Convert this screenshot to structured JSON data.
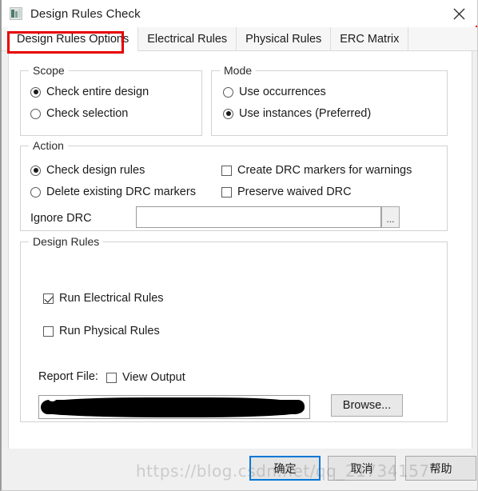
{
  "window": {
    "title": "Design Rules Check",
    "icon": "app-icon",
    "close_label": "✕"
  },
  "tabs": [
    {
      "label": "Design Rules Options",
      "active": true
    },
    {
      "label": "Electrical Rules",
      "active": false
    },
    {
      "label": "Physical Rules",
      "active": false
    },
    {
      "label": "ERC Matrix",
      "active": false
    }
  ],
  "annotation": {
    "color": "#e60000",
    "target": "Design Rules Options"
  },
  "scope": {
    "title": "Scope",
    "options": [
      {
        "label": "Check entire design",
        "selected": true
      },
      {
        "label": "Check selection",
        "selected": false
      }
    ]
  },
  "mode": {
    "title": "Mode",
    "options": [
      {
        "label": "Use occurrences",
        "selected": false
      },
      {
        "label": "Use instances (Preferred)",
        "selected": true
      }
    ]
  },
  "action": {
    "title": "Action",
    "radios": [
      {
        "label": "Check design rules",
        "selected": true
      },
      {
        "label": "Delete existing DRC markers",
        "selected": false
      }
    ],
    "checkboxes": [
      {
        "label": "Create DRC markers for warnings",
        "checked": false
      },
      {
        "label": "Preserve waived DRC",
        "checked": false
      }
    ],
    "ignore_drc": {
      "label": "Ignore DRC",
      "value": "",
      "placeholder": "",
      "browse_label": "..."
    }
  },
  "design_rules": {
    "title": "Design Rules",
    "checkboxes": [
      {
        "label": "Run Electrical Rules",
        "checked": true
      },
      {
        "label": "Run Physical Rules",
        "checked": false
      }
    ],
    "report": {
      "label": "Report File:",
      "view_output_label": "View Output",
      "view_output_checked": false,
      "path_value": "",
      "path_redacted": true,
      "browse_label": "Browse..."
    }
  },
  "footer": {
    "ok_label": "确定",
    "cancel_label": "取消",
    "help_label": "帮助",
    "focus_color": "#0078d7"
  },
  "watermark": {
    "text": "https://blog.csdn.net/qq_21734157"
  }
}
